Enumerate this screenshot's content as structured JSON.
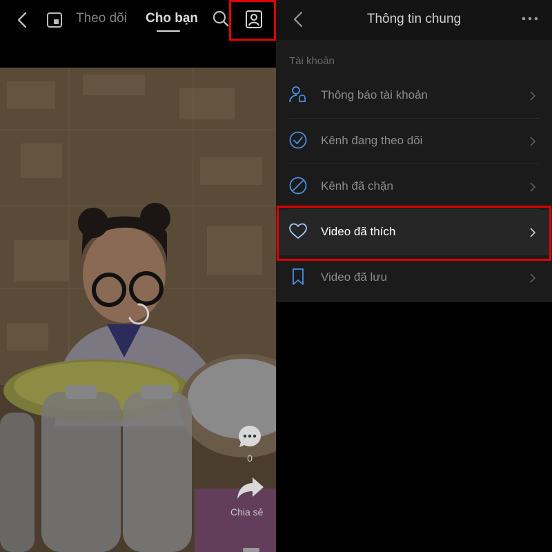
{
  "left_panel": {
    "tabs": [
      {
        "label": "Theo dõi",
        "active": false
      },
      {
        "label": "Cho bạn",
        "active": true
      }
    ],
    "icons": {
      "back": "chevron-left-icon",
      "pip": "picture-in-picture-icon",
      "search": "search-icon",
      "profile": "user-profile-icon"
    },
    "actions": {
      "comment_count": "0",
      "share_label": "Chia sẻ"
    },
    "highlight_color": "#e00000"
  },
  "right_panel": {
    "title": "Thông tin chung",
    "section_label": "Tài khoản",
    "items": [
      {
        "label": "Thông báo tài khoản",
        "icon": "account-notification-icon",
        "active": false
      },
      {
        "label": "Kênh đang theo dõi",
        "icon": "check-circle-icon",
        "active": false
      },
      {
        "label": "Kênh đã chặn",
        "icon": "blocked-icon",
        "active": false
      },
      {
        "label": "Video đã thích",
        "icon": "heart-icon",
        "active": true
      },
      {
        "label": "Video đã lưu",
        "icon": "bookmark-icon",
        "active": false
      }
    ],
    "accent_color": "#4a90e2"
  }
}
